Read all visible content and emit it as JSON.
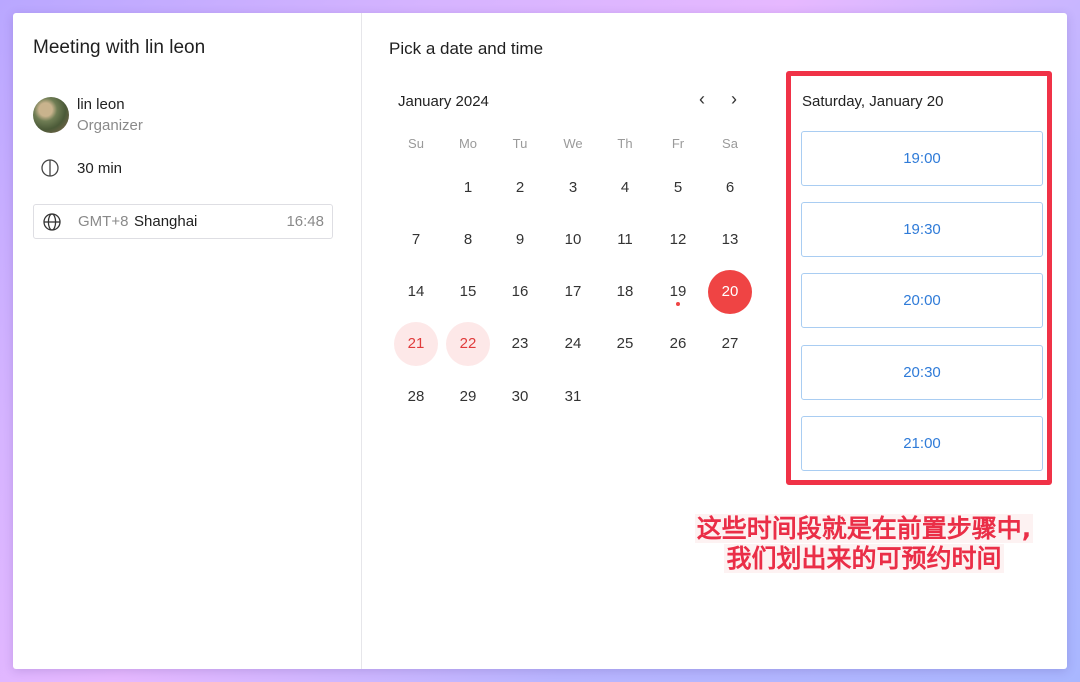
{
  "meeting": {
    "title": "Meeting with lin leon",
    "organizer_name": "lin leon",
    "organizer_role": "Organizer",
    "duration": "30 min",
    "timezone_offset": "GMT+8",
    "timezone_city": "Shanghai",
    "current_time": "16:48"
  },
  "picker": {
    "title": "Pick a date and time",
    "month_label": "January 2024",
    "prev_icon": "‹",
    "next_icon": "›",
    "weekdays": [
      "Su",
      "Mo",
      "Tu",
      "We",
      "Th",
      "Fr",
      "Sa"
    ],
    "weeks": [
      [
        "",
        "1",
        "2",
        "3",
        "4",
        "5",
        "6"
      ],
      [
        "7",
        "8",
        "9",
        "10",
        "11",
        "12",
        "13"
      ],
      [
        "14",
        "15",
        "16",
        "17",
        "18",
        "19",
        "20"
      ],
      [
        "21",
        "22",
        "23",
        "24",
        "25",
        "26",
        "27"
      ],
      [
        "28",
        "29",
        "30",
        "31",
        "",
        "",
        ""
      ]
    ],
    "selected_day": "20",
    "today_day": "19",
    "available_days": [
      "21",
      "22"
    ]
  },
  "slots": {
    "date_label": "Saturday, January 20",
    "times": [
      "19:00",
      "19:30",
      "20:00",
      "20:30",
      "21:00"
    ]
  },
  "annotation": {
    "line1": "这些时间段就是在前置步骤中,",
    "line2": "我们划出来的可预约时间"
  },
  "colors": {
    "accent": "#ef4444",
    "slot_text": "#2f7bd8",
    "highlight_border": "#f03247"
  }
}
